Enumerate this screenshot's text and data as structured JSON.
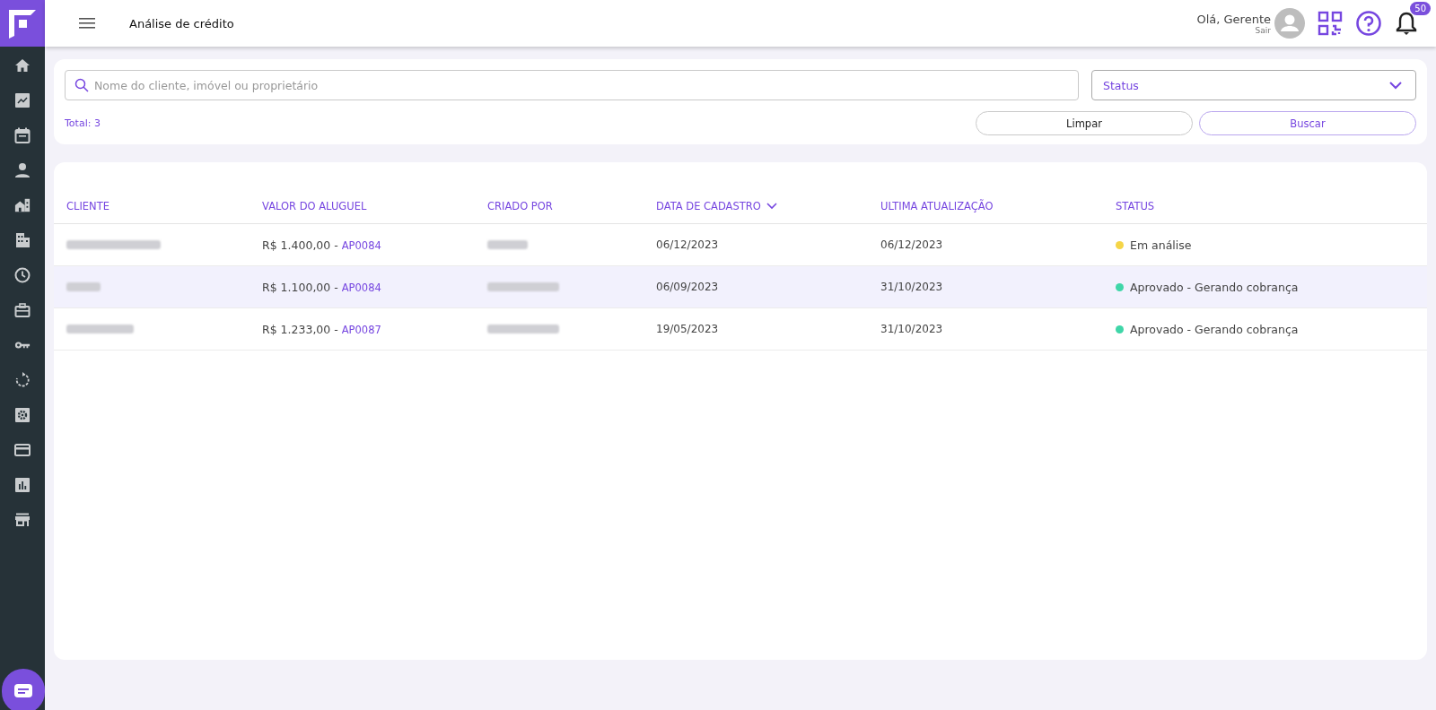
{
  "header": {
    "title": "Análise de crédito",
    "greeting": "Olá, Gerente",
    "logout": "Sair",
    "notifications": "50"
  },
  "sidebar": {
    "items": [
      {
        "kind": "home"
      },
      {
        "kind": "chart"
      },
      {
        "kind": "calendar"
      },
      {
        "kind": "person"
      },
      {
        "kind": "house"
      },
      {
        "kind": "buildings"
      },
      {
        "kind": "clock"
      },
      {
        "kind": "briefcase"
      },
      {
        "kind": "key"
      },
      {
        "kind": "refresh"
      },
      {
        "kind": "gear"
      },
      {
        "kind": "card"
      },
      {
        "kind": "bars"
      },
      {
        "kind": "store"
      }
    ]
  },
  "filters": {
    "search": {
      "placeholder": "Nome do cliente, imóvel ou proprietário"
    },
    "status": {
      "placeholder": "Status"
    },
    "total": "Total: 3",
    "buttons": [
      "Limpar",
      "Buscar"
    ]
  },
  "table": {
    "columns": [
      {
        "label": "CLIENTE",
        "sorted": false
      },
      {
        "label": "VALOR DO ALUGUEL",
        "sorted": false
      },
      {
        "label": "CRIADO POR",
        "sorted": false
      },
      {
        "label": "DATA DE CADASTRO",
        "sorted": true
      },
      {
        "label": "ULTIMA ATUALIZAÇÃO",
        "sorted": false
      },
      {
        "label": "STATUS",
        "sorted": false
      }
    ],
    "rows": [
      {
        "selected": false,
        "value": "R$ 1.400,00 -",
        "code": "AP0084",
        "created": "06/12/2023",
        "updated": "06/12/2023",
        "status": "Em análise",
        "color": "#f5d547"
      },
      {
        "selected": true,
        "value": "R$ 1.100,00 -",
        "code": "AP0084",
        "created": "06/09/2023",
        "updated": "31/10/2023",
        "status": "Aprovado - Gerando cobrança",
        "color": "#3fd6a8"
      },
      {
        "selected": false,
        "value": "R$ 1.233,00 -",
        "code": "AP0087",
        "created": "19/05/2023",
        "updated": "31/10/2023",
        "status": "Aprovado - Gerando cobrança",
        "color": "#3fd6a8"
      }
    ]
  }
}
